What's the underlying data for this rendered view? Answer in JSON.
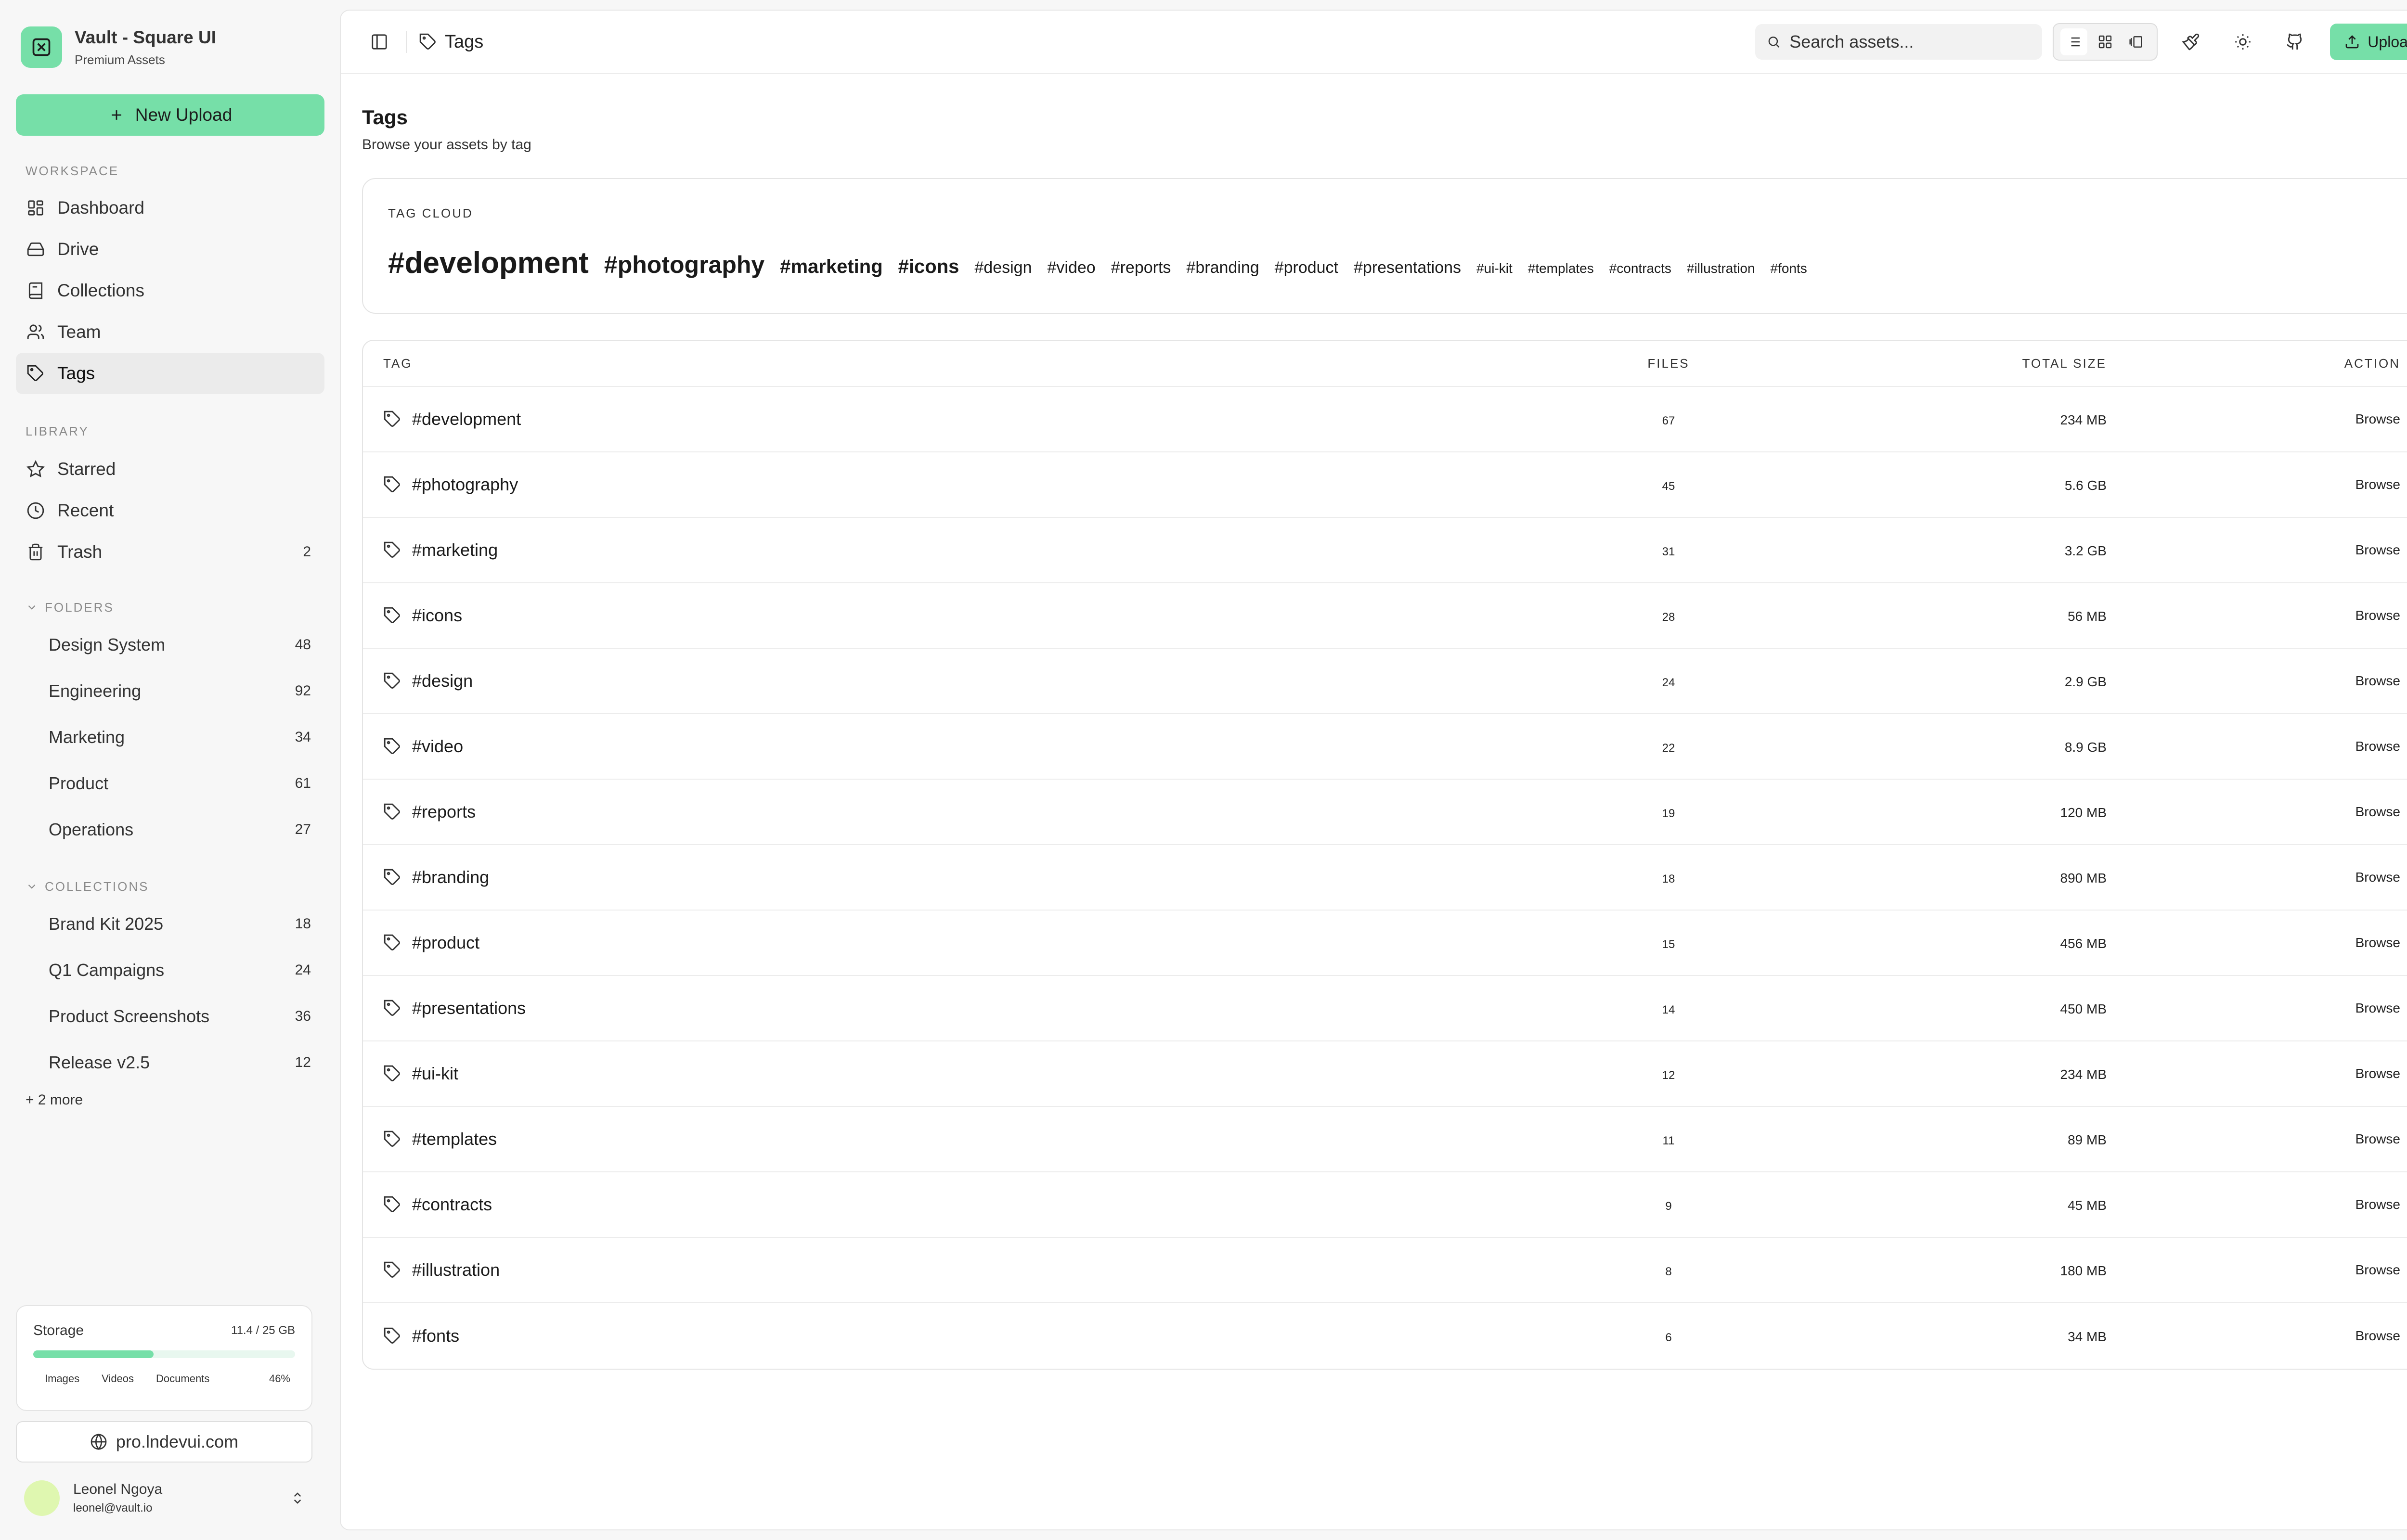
{
  "sidebar": {
    "brand": {
      "title": "Vault - Square UI",
      "subtitle": "Premium Assets"
    },
    "new_upload_label": "New Upload",
    "workspace_label": "WORKSPACE",
    "workspace": [
      {
        "label": "Dashboard",
        "icon": "dashboard-icon"
      },
      {
        "label": "Drive",
        "icon": "drive-icon"
      },
      {
        "label": "Collections",
        "icon": "collections-icon"
      },
      {
        "label": "Team",
        "icon": "team-icon"
      },
      {
        "label": "Tags",
        "icon": "tag-icon",
        "active": true
      }
    ],
    "library_label": "LIBRARY",
    "library": [
      {
        "label": "Starred",
        "icon": "star-icon"
      },
      {
        "label": "Recent",
        "icon": "clock-icon"
      },
      {
        "label": "Trash",
        "icon": "trash-icon",
        "count": "2"
      }
    ],
    "folders_label": "FOLDERS",
    "folders": [
      {
        "label": "Design System",
        "count": "48"
      },
      {
        "label": "Engineering",
        "count": "92"
      },
      {
        "label": "Marketing",
        "count": "34"
      },
      {
        "label": "Product",
        "count": "61"
      },
      {
        "label": "Operations",
        "count": "27"
      }
    ],
    "collections_label": "COLLECTIONS",
    "collections": [
      {
        "label": "Brand Kit 2025",
        "count": "18"
      },
      {
        "label": "Q1 Campaigns",
        "count": "24"
      },
      {
        "label": "Product Screenshots",
        "count": "36"
      },
      {
        "label": "Release v2.5",
        "count": "12"
      }
    ],
    "more_label": "+ 2 more",
    "storage": {
      "title": "Storage",
      "used": "11.4 / 25 GB",
      "fill_percent": 46,
      "legend": [
        "Images",
        "Videos",
        "Documents"
      ],
      "percent_label": "46%"
    },
    "site_link": "pro.lndevui.com",
    "user": {
      "name": "Leonel Ngoya",
      "email": "leonel@vault.io"
    }
  },
  "topbar": {
    "breadcrumb": "Tags",
    "search_placeholder": "Search assets...",
    "upload_label": "Upload"
  },
  "page": {
    "title": "Tags",
    "subtitle": "Browse your assets by tag"
  },
  "tag_cloud": {
    "label": "TAG CLOUD",
    "tags": [
      {
        "label": "#development",
        "weight": 5
      },
      {
        "label": "#photography",
        "weight": 4
      },
      {
        "label": "#marketing",
        "weight": 3
      },
      {
        "label": "#icons",
        "weight": 3
      },
      {
        "label": "#design",
        "weight": 2
      },
      {
        "label": "#video",
        "weight": 2
      },
      {
        "label": "#reports",
        "weight": 2
      },
      {
        "label": "#branding",
        "weight": 2
      },
      {
        "label": "#product",
        "weight": 2
      },
      {
        "label": "#presentations",
        "weight": 2
      },
      {
        "label": "#ui-kit",
        "weight": 1
      },
      {
        "label": "#templates",
        "weight": 1
      },
      {
        "label": "#contracts",
        "weight": 1
      },
      {
        "label": "#illustration",
        "weight": 1
      },
      {
        "label": "#fonts",
        "weight": 1
      }
    ]
  },
  "table": {
    "headers": {
      "tag": "TAG",
      "files": "FILES",
      "size": "TOTAL SIZE",
      "action": "ACTION"
    },
    "rows": [
      {
        "tag": "#development",
        "files": "67",
        "size": "234 MB",
        "action": "Browse"
      },
      {
        "tag": "#photography",
        "files": "45",
        "size": "5.6 GB",
        "action": "Browse"
      },
      {
        "tag": "#marketing",
        "files": "31",
        "size": "3.2 GB",
        "action": "Browse"
      },
      {
        "tag": "#icons",
        "files": "28",
        "size": "56 MB",
        "action": "Browse"
      },
      {
        "tag": "#design",
        "files": "24",
        "size": "2.9 GB",
        "action": "Browse"
      },
      {
        "tag": "#video",
        "files": "22",
        "size": "8.9 GB",
        "action": "Browse"
      },
      {
        "tag": "#reports",
        "files": "19",
        "size": "120 MB",
        "action": "Browse"
      },
      {
        "tag": "#branding",
        "files": "18",
        "size": "890 MB",
        "action": "Browse"
      },
      {
        "tag": "#product",
        "files": "15",
        "size": "456 MB",
        "action": "Browse"
      },
      {
        "tag": "#presentations",
        "files": "14",
        "size": "450 MB",
        "action": "Browse"
      },
      {
        "tag": "#ui-kit",
        "files": "12",
        "size": "234 MB",
        "action": "Browse"
      },
      {
        "tag": "#templates",
        "files": "11",
        "size": "89 MB",
        "action": "Browse"
      },
      {
        "tag": "#contracts",
        "files": "9",
        "size": "45 MB",
        "action": "Browse"
      },
      {
        "tag": "#illustration",
        "files": "8",
        "size": "180 MB",
        "action": "Browse"
      },
      {
        "tag": "#fonts",
        "files": "6",
        "size": "34 MB",
        "action": "Browse"
      }
    ]
  },
  "colors": {
    "accent": "#76dfa8",
    "active_nav": "#ebebeb",
    "avatar": "#dff7b0"
  }
}
